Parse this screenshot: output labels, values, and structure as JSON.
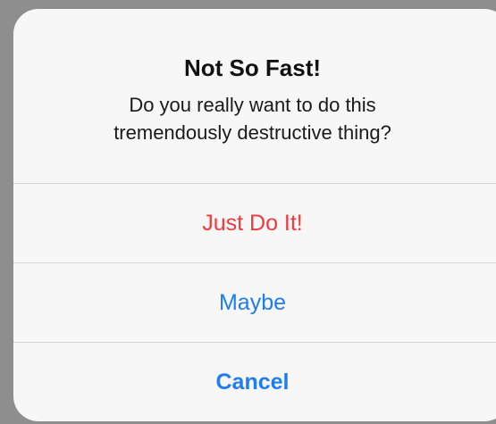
{
  "alert": {
    "title": "Not So Fast!",
    "message_line1": "Do you really want to do this",
    "message_line2": "tremendously destructive thing?",
    "actions": [
      {
        "label": "Just Do It!",
        "style": "destructive",
        "color": "#f13a3d"
      },
      {
        "label": "Maybe",
        "style": "default",
        "color": "#1f7cf2"
      },
      {
        "label": "Cancel",
        "style": "cancel",
        "color": "#1f7cf2"
      }
    ]
  }
}
